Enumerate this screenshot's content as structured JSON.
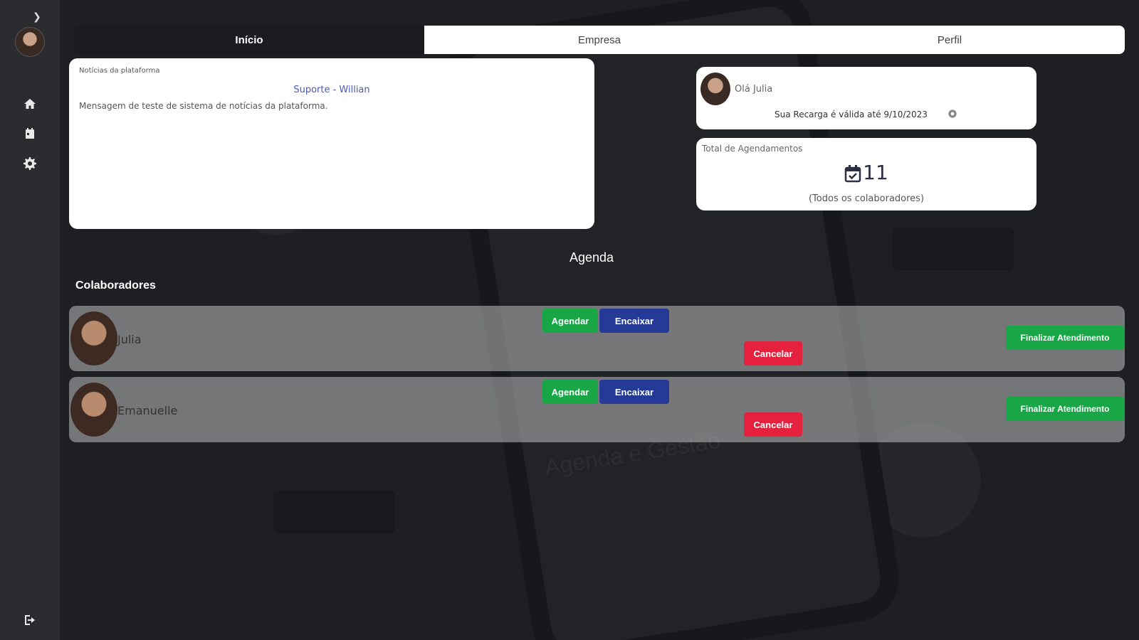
{
  "tabs": [
    {
      "label": "Início"
    },
    {
      "label": "Empresa"
    },
    {
      "label": "Perfil"
    }
  ],
  "news": {
    "title": "Notícias da plataforma",
    "author": "Suporte - Willian",
    "message": "Mensagem de teste de sistema de notícias da plataforma."
  },
  "user_card": {
    "greeting": "Olá Julia",
    "recharge_text": "Sua Recarga é válida até 9/10/2023"
  },
  "total_card": {
    "title": "Total de Agendamentos",
    "count": "11",
    "subtitle": "(Todos os colaboradores)"
  },
  "agenda": {
    "title": "Agenda",
    "collaborators_title": "Colaboradores",
    "rows": [
      {
        "name": "Julia",
        "schedule_label": "Agendar",
        "fit_label": "Encaixar",
        "cancel_label": "Cancelar",
        "finish_label": "Finalizar Atendimento"
      },
      {
        "name": "Emanuelle",
        "schedule_label": "Agendar",
        "fit_label": "Encaixar",
        "cancel_label": "Cancelar",
        "finish_label": "Finalizar Atendimento"
      }
    ]
  },
  "background": {
    "watermark_text": "Agenda e Gestão"
  },
  "colors": {
    "green": "#19a647",
    "blue": "#243a96",
    "red": "#e5213e",
    "sidebar": "#2b2c30"
  },
  "icons": {
    "sidebar": [
      "chevron-right-icon",
      "home-icon",
      "calendar-icon",
      "gear-icon",
      "logout-icon"
    ]
  }
}
